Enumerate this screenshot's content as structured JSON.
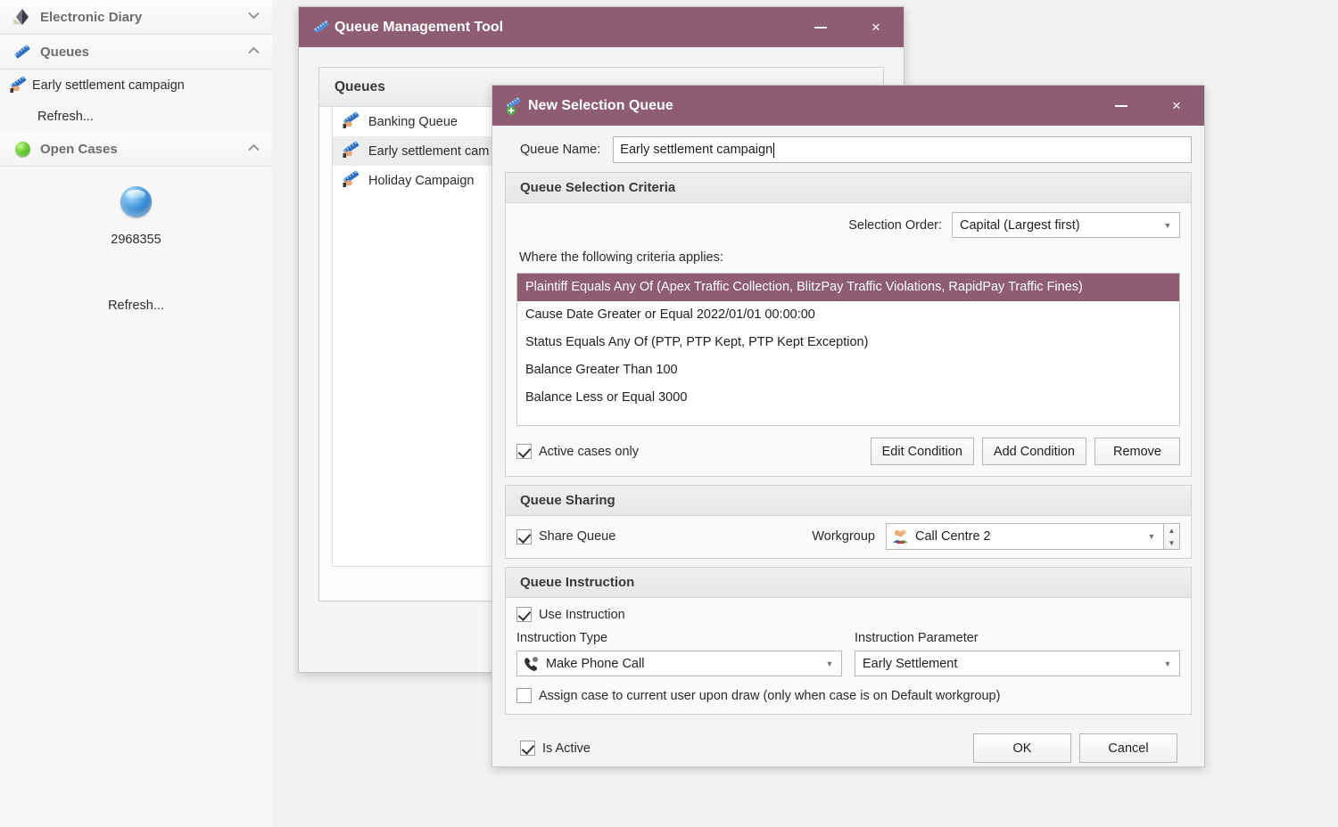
{
  "sidebar": {
    "sections": [
      {
        "title": "Electronic Diary",
        "icon": "diary-icon",
        "chevron": "chevron-down-icon"
      },
      {
        "title": "Queues",
        "icon": "queue-icon",
        "chevron": "chevron-up-icon"
      },
      {
        "title": "Open Cases",
        "icon": "green-sphere-icon",
        "chevron": "chevron-up-icon"
      }
    ],
    "queue_item": "Early settlement campaign",
    "queue_refresh": "Refresh...",
    "open_cases_count": "2968355",
    "open_cases_refresh": "Refresh..."
  },
  "qmt_window": {
    "title": "Queue Management Tool",
    "icon": "queue-icon",
    "minimize_label": "–",
    "close_label": "×",
    "panel_header": "Queues",
    "queues": [
      {
        "label": "Banking Queue",
        "selected": false
      },
      {
        "label": "Early settlement cam",
        "selected": true
      },
      {
        "label": "Holiday Campaign",
        "selected": false
      }
    ]
  },
  "dialog": {
    "title": "New Selection Queue",
    "icon": "new-queue-icon",
    "minimize_label": "–",
    "close_label": "×",
    "queue_name_label": "Queue Name:",
    "queue_name_value": "Early settlement campaign",
    "criteria": {
      "group_title": "Queue Selection Criteria",
      "selection_order_label": "Selection Order:",
      "selection_order_value": "Capital (Largest first)",
      "criteria_intro": "Where the following criteria applies:",
      "items": [
        {
          "text": "Plaintiff Equals Any Of (Apex Traffic Collection, BlitzPay Traffic Violations, RapidPay Traffic Fines)",
          "selected": true
        },
        {
          "text": "Cause Date Greater or Equal 2022/01/01 00:00:00",
          "selected": false
        },
        {
          "text": "Status Equals Any Of (PTP, PTP Kept, PTP Kept Exception)",
          "selected": false
        },
        {
          "text": "Balance Greater Than 100",
          "selected": false
        },
        {
          "text": "Balance Less or Equal 3000",
          "selected": false
        }
      ],
      "active_cases_only_label": "Active cases only",
      "active_cases_only_checked": true,
      "edit_condition_label": "Edit Condition",
      "add_condition_label": "Add Condition",
      "remove_label": "Remove"
    },
    "sharing": {
      "group_title": "Queue Sharing",
      "share_queue_label": "Share Queue",
      "share_queue_checked": true,
      "workgroup_label": "Workgroup",
      "workgroup_value": "Call Centre 2",
      "workgroup_icon": "workgroup-people-icon"
    },
    "instruction": {
      "group_title": "Queue Instruction",
      "use_instruction_label": "Use Instruction",
      "use_instruction_checked": true,
      "instruction_type_label": "Instruction Type",
      "instruction_type_value": "Make Phone Call",
      "instruction_type_icon": "phone-call-icon",
      "instruction_parameter_label": "Instruction Parameter",
      "instruction_parameter_value": "Early Settlement",
      "assign_case_label": "Assign case to current user upon draw (only when case is on Default workgroup)",
      "assign_case_checked": false
    },
    "footer": {
      "is_active_label": "Is Active",
      "is_active_checked": true,
      "ok_label": "OK",
      "cancel_label": "Cancel"
    }
  },
  "colors": {
    "titlebar": "#8e5d72",
    "selection": "#8e5d72",
    "page_bg": "#f2f2f2"
  }
}
